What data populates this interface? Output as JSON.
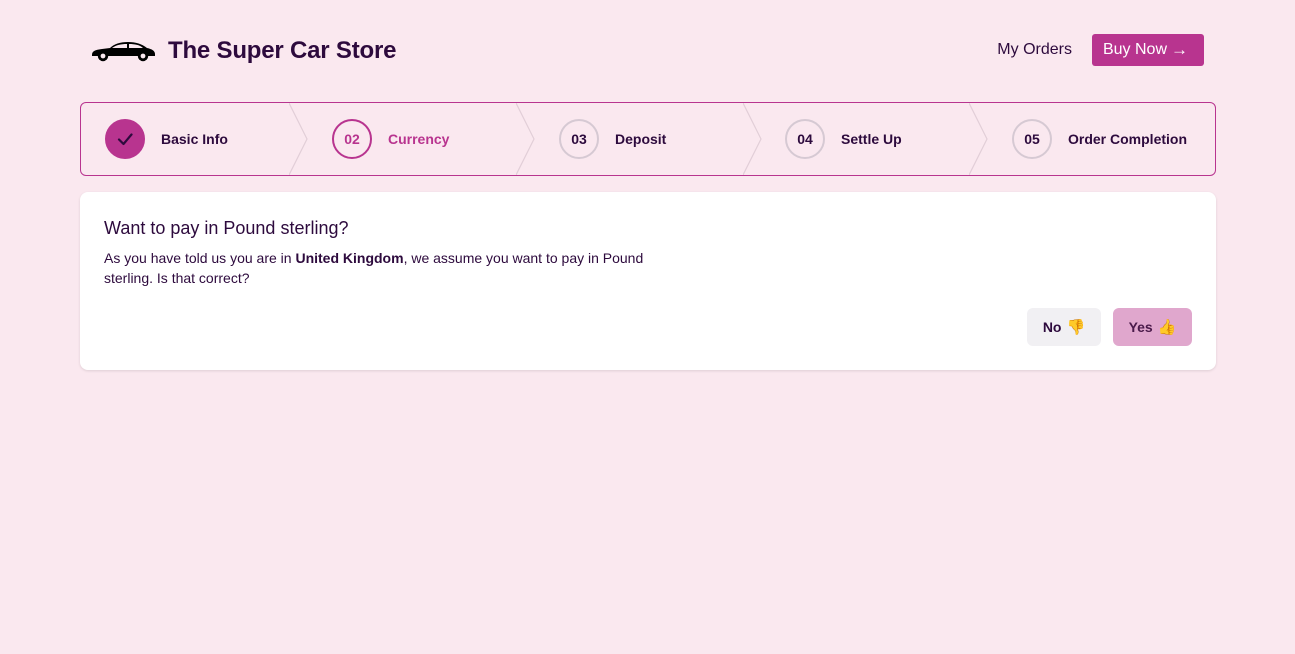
{
  "header": {
    "brand_title": "The Super Car Store",
    "brand_icon": "car-icon",
    "nav_my_orders": "My Orders",
    "buy_now_label": "Buy Now",
    "buy_now_icon": "→"
  },
  "stepper": {
    "steps": [
      {
        "number": "",
        "label": "Basic Info",
        "state": "complete"
      },
      {
        "number": "02",
        "label": "Currency",
        "state": "current"
      },
      {
        "number": "03",
        "label": "Deposit",
        "state": "upcoming"
      },
      {
        "number": "04",
        "label": "Settle Up",
        "state": "upcoming"
      },
      {
        "number": "05",
        "label": "Order Completion",
        "state": "upcoming"
      }
    ]
  },
  "card": {
    "title": "Want to pay in Pound sterling?",
    "text_before": "As you have told us you are in ",
    "country": "United Kingdom",
    "text_after": ", we assume you want to pay in Pound sterling. Is that correct?",
    "no_label": "No",
    "no_icon": "👎",
    "yes_label": "Yes",
    "yes_icon": "👍"
  },
  "colors": {
    "background": "#fae8ef",
    "accent": "#b8348f",
    "text": "#2d0a3d",
    "yes_button": "#e0a7cd",
    "no_button": "#f1f0f3"
  }
}
